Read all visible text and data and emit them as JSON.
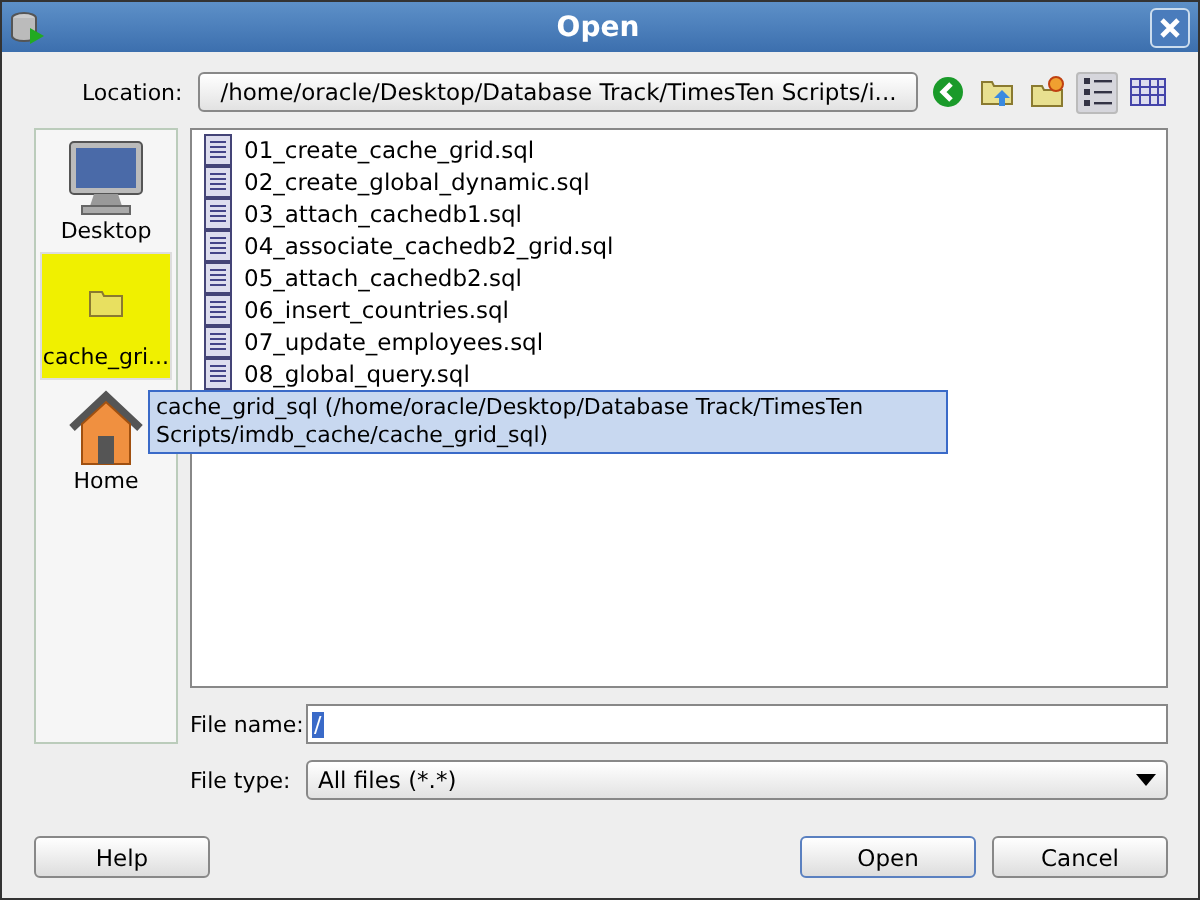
{
  "window": {
    "title": "Open"
  },
  "location": {
    "label": "Location:",
    "value": "/home/oracle/Desktop/Database Track/TimesTen Scripts/i..."
  },
  "toolbar": [
    {
      "kind": "back"
    },
    {
      "kind": "up"
    },
    {
      "kind": "new-folder"
    },
    {
      "kind": "list",
      "selected": true
    },
    {
      "kind": "details",
      "selected": false
    }
  ],
  "places": [
    {
      "label": "Desktop",
      "kind": "desktop",
      "selected": false
    },
    {
      "label": "cache_gri...",
      "kind": "folder",
      "selected": true
    },
    {
      "label": "Home",
      "kind": "home",
      "selected": false
    }
  ],
  "files": [
    "01_create_cache_grid.sql",
    "02_create_global_dynamic.sql",
    "03_attach_cachedb1.sql",
    "04_associate_cachedb2_grid.sql",
    "05_attach_cachedb2.sql",
    "06_insert_countries.sql",
    "07_update_employees.sql",
    "08_global_query.sql"
  ],
  "tooltip": "cache_grid_sql (/home/oracle/Desktop/Database Track/TimesTen Scripts/imdb_cache/cache_grid_sql)",
  "file_name": {
    "label": "File name:",
    "value": "/"
  },
  "file_type": {
    "label": "File type:",
    "value": "All files (*.*)"
  },
  "buttons": {
    "help": "Help",
    "open": "Open",
    "cancel": "Cancel"
  }
}
